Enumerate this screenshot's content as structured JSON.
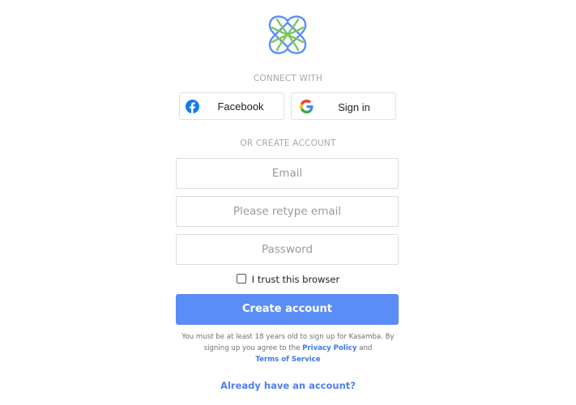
{
  "logo": {
    "icon": "kasamba-logo-icon",
    "colors": [
      "#5b8ff6",
      "#7bc660"
    ]
  },
  "connect_label": "CONNECT WITH",
  "social": {
    "facebook": {
      "label": "Facebook",
      "icon": "facebook-icon",
      "color": "#1877f2"
    },
    "google": {
      "label": "Sign in",
      "icon": "google-icon",
      "colors": [
        "#4285f4",
        "#ea4335",
        "#fbbc05",
        "#34a853"
      ]
    }
  },
  "create_label": "OR CREATE ACCOUNT",
  "form": {
    "email": {
      "value": "",
      "placeholder": "Email"
    },
    "retype_email": {
      "value": "",
      "placeholder": "Please retype email"
    },
    "password": {
      "value": "",
      "placeholder": "Password"
    },
    "trust_browser": {
      "label": "I trust this browser",
      "checked": false
    }
  },
  "create_button": {
    "label": "Create account",
    "color": "#5a8df6"
  },
  "legal": {
    "text_before": "You must be at least 18 years old to sign up for Kasamba. By signing up you agree to the",
    "privacy_link": "Privacy Policy",
    "text_and": "and",
    "terms_link": "Terms of Service"
  },
  "signin_link": "Already have an account?"
}
